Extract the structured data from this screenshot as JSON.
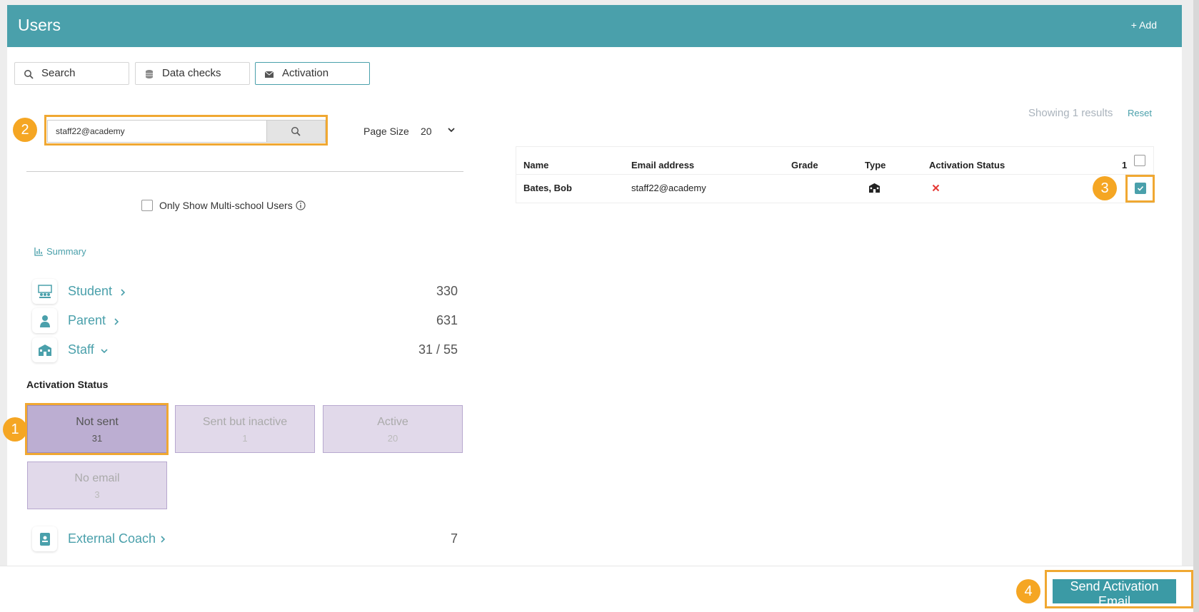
{
  "header": {
    "title": "Users",
    "add_label": "+ Add"
  },
  "tabs": [
    {
      "label": "Search",
      "icon": "search-icon"
    },
    {
      "label": "Data checks",
      "icon": "database-icon"
    },
    {
      "label": "Activation",
      "icon": "envelope-icon"
    }
  ],
  "search": {
    "value": "staff22@academy",
    "button_icon": "search-icon"
  },
  "page_size": {
    "label": "Page Size",
    "value": "20"
  },
  "multi_school": {
    "label": "Only Show Multi-school Users",
    "checked": false
  },
  "summary_link": "Summary",
  "categories": [
    {
      "label": "Student",
      "count": "330",
      "icon": "classroom-icon",
      "expanded": false
    },
    {
      "label": "Parent",
      "count": "631",
      "icon": "person-icon",
      "expanded": false
    },
    {
      "label": "Staff",
      "count": "31 / 55",
      "icon": "school-icon",
      "expanded": true
    },
    {
      "label": "External Coach",
      "count": "7",
      "icon": "badge-icon",
      "expanded": false
    }
  ],
  "activation": {
    "heading": "Activation Status",
    "statuses": [
      {
        "label": "Not sent",
        "count": "31",
        "selected": true
      },
      {
        "label": "Sent but inactive",
        "count": "1",
        "selected": false
      },
      {
        "label": "Active",
        "count": "20",
        "selected": false
      },
      {
        "label": "No email",
        "count": "3",
        "selected": false
      }
    ]
  },
  "results": {
    "showing": "Showing 1 results",
    "reset": "Reset",
    "columns": [
      "Name",
      "Email address",
      "Grade",
      "Type",
      "Activation Status"
    ],
    "selected_count": "1",
    "rows": [
      {
        "name": "Bates, Bob",
        "email": "staff22@academy",
        "grade": "",
        "type_icon": "school-icon",
        "status_icon": "x-icon",
        "checked": true
      }
    ]
  },
  "callouts": [
    "1",
    "2",
    "3",
    "4"
  ],
  "send_button": "Send Activation Email",
  "colors": {
    "accent": "#4aa0ab",
    "callout": "#f5a623",
    "status_fill": "#e1d9ea",
    "status_selected": "#bcaed2",
    "error": "#e53935"
  }
}
